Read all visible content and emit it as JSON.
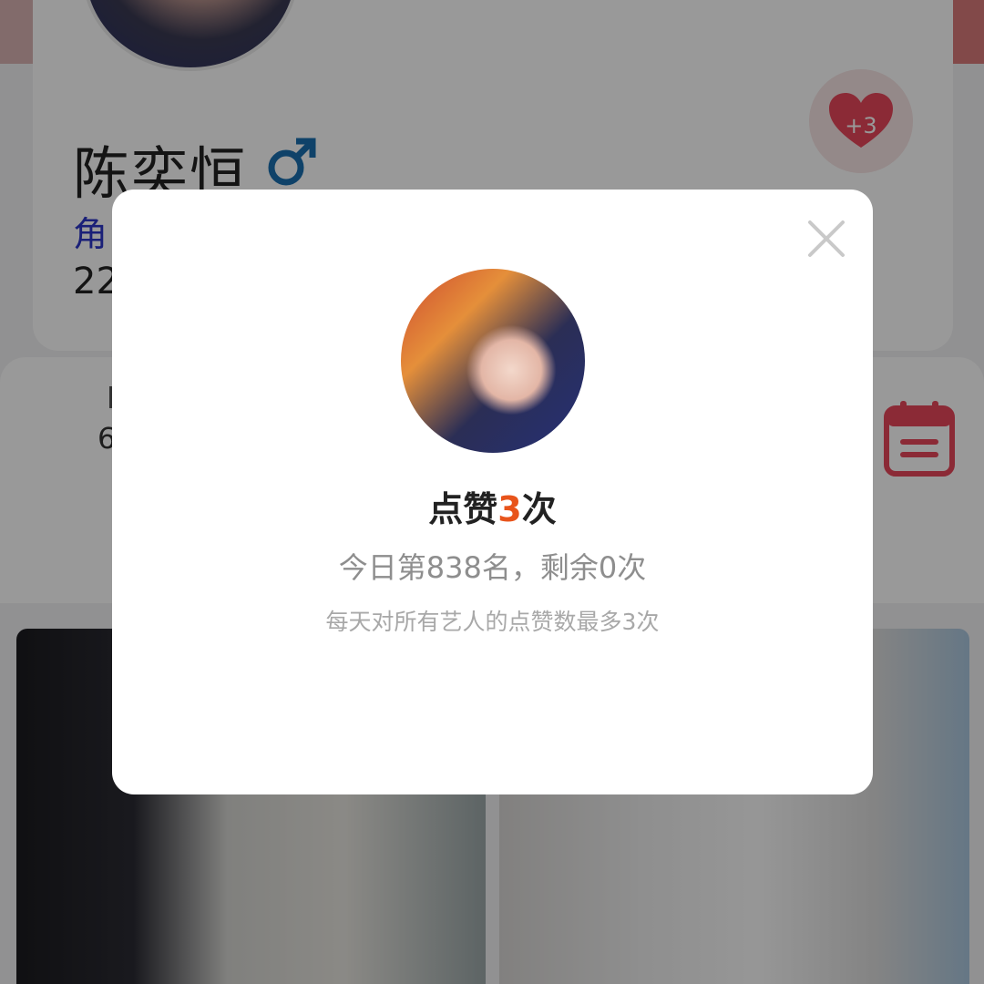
{
  "profile": {
    "name": "陈奕恒",
    "gender_symbol": "♂",
    "role_fragment": "角",
    "number_fragment": "22",
    "like_badge_label": "+3"
  },
  "stats": {
    "fragment": "6"
  },
  "modal": {
    "title_prefix": "点赞",
    "title_count": "3",
    "title_suffix": "次",
    "subtitle": "今日第838名，剩余0次",
    "note": "每天对所有艺人的点赞数最多3次"
  },
  "colors": {
    "accent_orange": "#e8541b",
    "heart_red": "#e8475a",
    "role_blue": "#2c36c8",
    "gender_blue": "#1a6fb0"
  }
}
